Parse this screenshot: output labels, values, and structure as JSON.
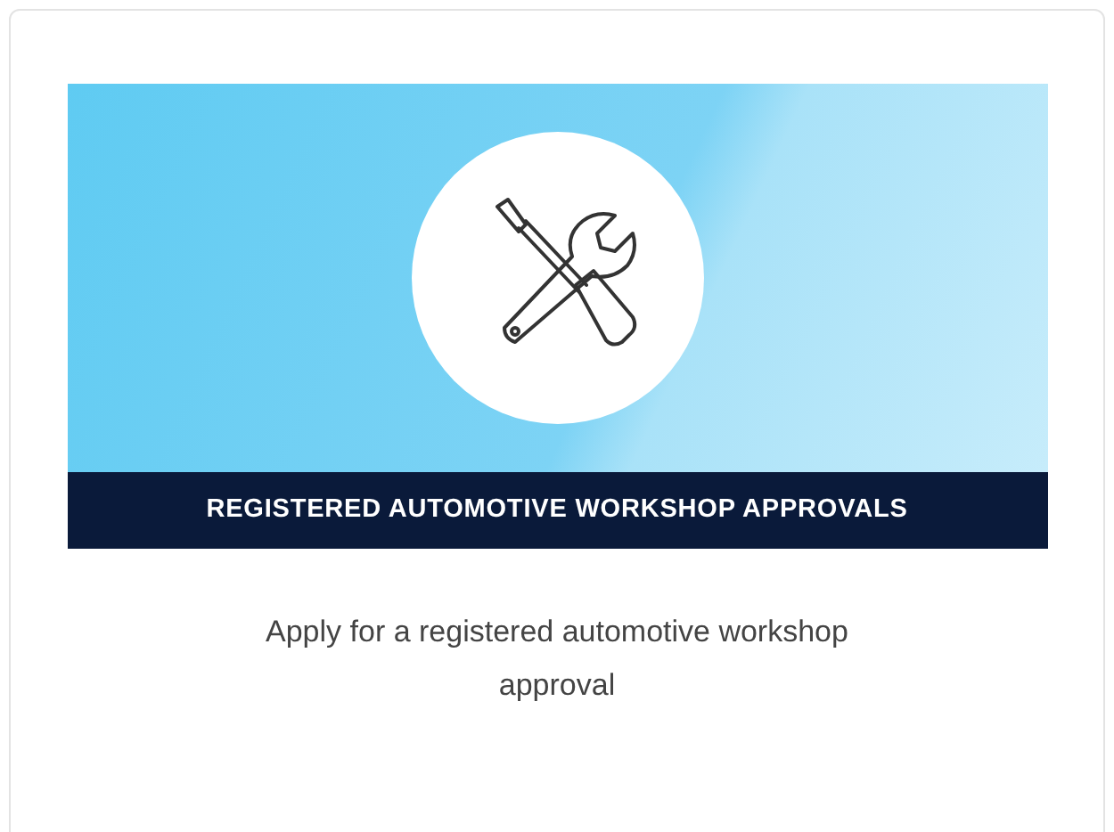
{
  "card": {
    "banner_title": "REGISTERED AUTOMOTIVE WORKSHOP APPROVALS",
    "description": "Apply for a registered automotive workshop approval"
  }
}
